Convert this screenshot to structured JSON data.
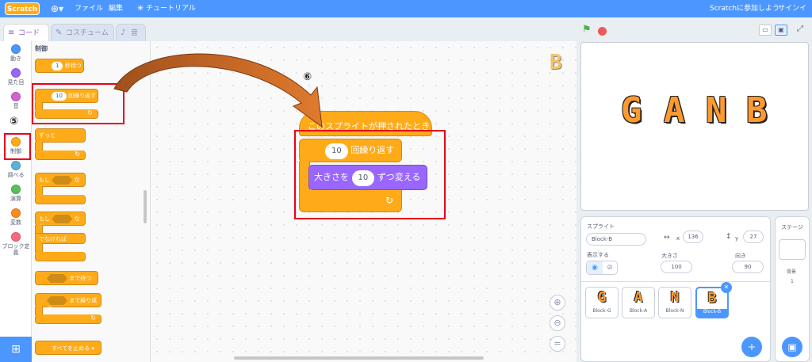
{
  "menubar": {
    "logo": "Scratch",
    "file": "ファイル",
    "edit": "編集",
    "tutorial": "チュートリアル",
    "join": "Scratchに参加しよう",
    "signin": "サインイン"
  },
  "tabs": {
    "code": "コード",
    "costume": "コスチューム",
    "sound": "音"
  },
  "categories": [
    {
      "label": "動き",
      "color": "#4c97ff"
    },
    {
      "label": "見た目",
      "color": "#9966ff"
    },
    {
      "label": "音",
      "color": "#cf63cf"
    },
    {
      "label": "制御",
      "color": "#ffab19"
    },
    {
      "label": "調べる",
      "color": "#5cb1d6"
    },
    {
      "label": "演算",
      "color": "#59c059"
    },
    {
      "label": "変数",
      "color": "#ff8c1a"
    },
    {
      "label": "ブロック定義",
      "color": "#ff6680"
    }
  ],
  "palette": {
    "heading": "制御",
    "wait_value": "1",
    "wait_label": "秒待つ",
    "repeat_value": "10",
    "repeat_label": "回繰り返す",
    "forever": "ずっと",
    "if_prefix": "もし",
    "if_suffix": "なら",
    "if2_prefix": "もし",
    "if2_suffix": "なら",
    "else": "でなければ",
    "wait_until": "まで待つ",
    "repeat_until": "まで繰り返す",
    "stop": "すべてを止める ▾"
  },
  "script": {
    "hat": "このスプライトが押されたとき",
    "repeat_value": "10",
    "repeat_label": "回繰り返す",
    "size_prefix": "大きさを",
    "size_value": "10",
    "size_suffix": "ずつ変える",
    "sprite_letter": "B"
  },
  "annotations": {
    "step5": "⑤",
    "step6": "⑥"
  },
  "stage": {
    "letters": [
      "G",
      "A",
      "N",
      "B"
    ]
  },
  "sprite_info": {
    "title": "スプライト",
    "name": "Block-B",
    "x_label": "x",
    "x": "136",
    "y_label": "y",
    "y": "27",
    "show_label": "表示する",
    "size_label": "大きさ",
    "size": "100",
    "direction_label": "向き",
    "direction": "90"
  },
  "sprites": [
    {
      "letter": "G",
      "name": "Block-G"
    },
    {
      "letter": "A",
      "name": "Block-A"
    },
    {
      "letter": "N",
      "name": "Block-N"
    },
    {
      "letter": "B",
      "name": "Block-B"
    }
  ],
  "stage_panel": {
    "title": "ステージ",
    "backdrop_label": "背景",
    "backdrop_count": "1"
  }
}
